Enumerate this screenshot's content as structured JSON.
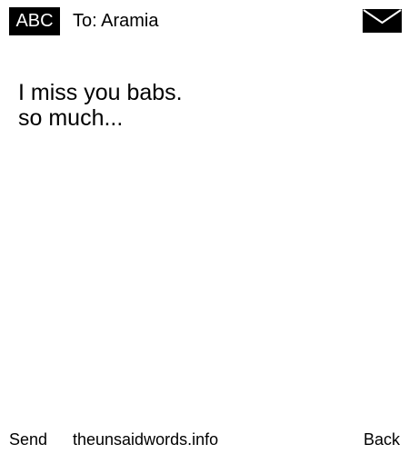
{
  "header": {
    "input_mode": "ABC",
    "recipient": "To: Aramia",
    "status_icon": "envelope-icon"
  },
  "message": {
    "lines": [
      "I miss you babs.",
      "so much..."
    ]
  },
  "softkeys": {
    "left": "Send",
    "center": "theunsaidwords.info",
    "right": "Back"
  },
  "colors": {
    "background": "#ffffff",
    "foreground": "#000000"
  }
}
